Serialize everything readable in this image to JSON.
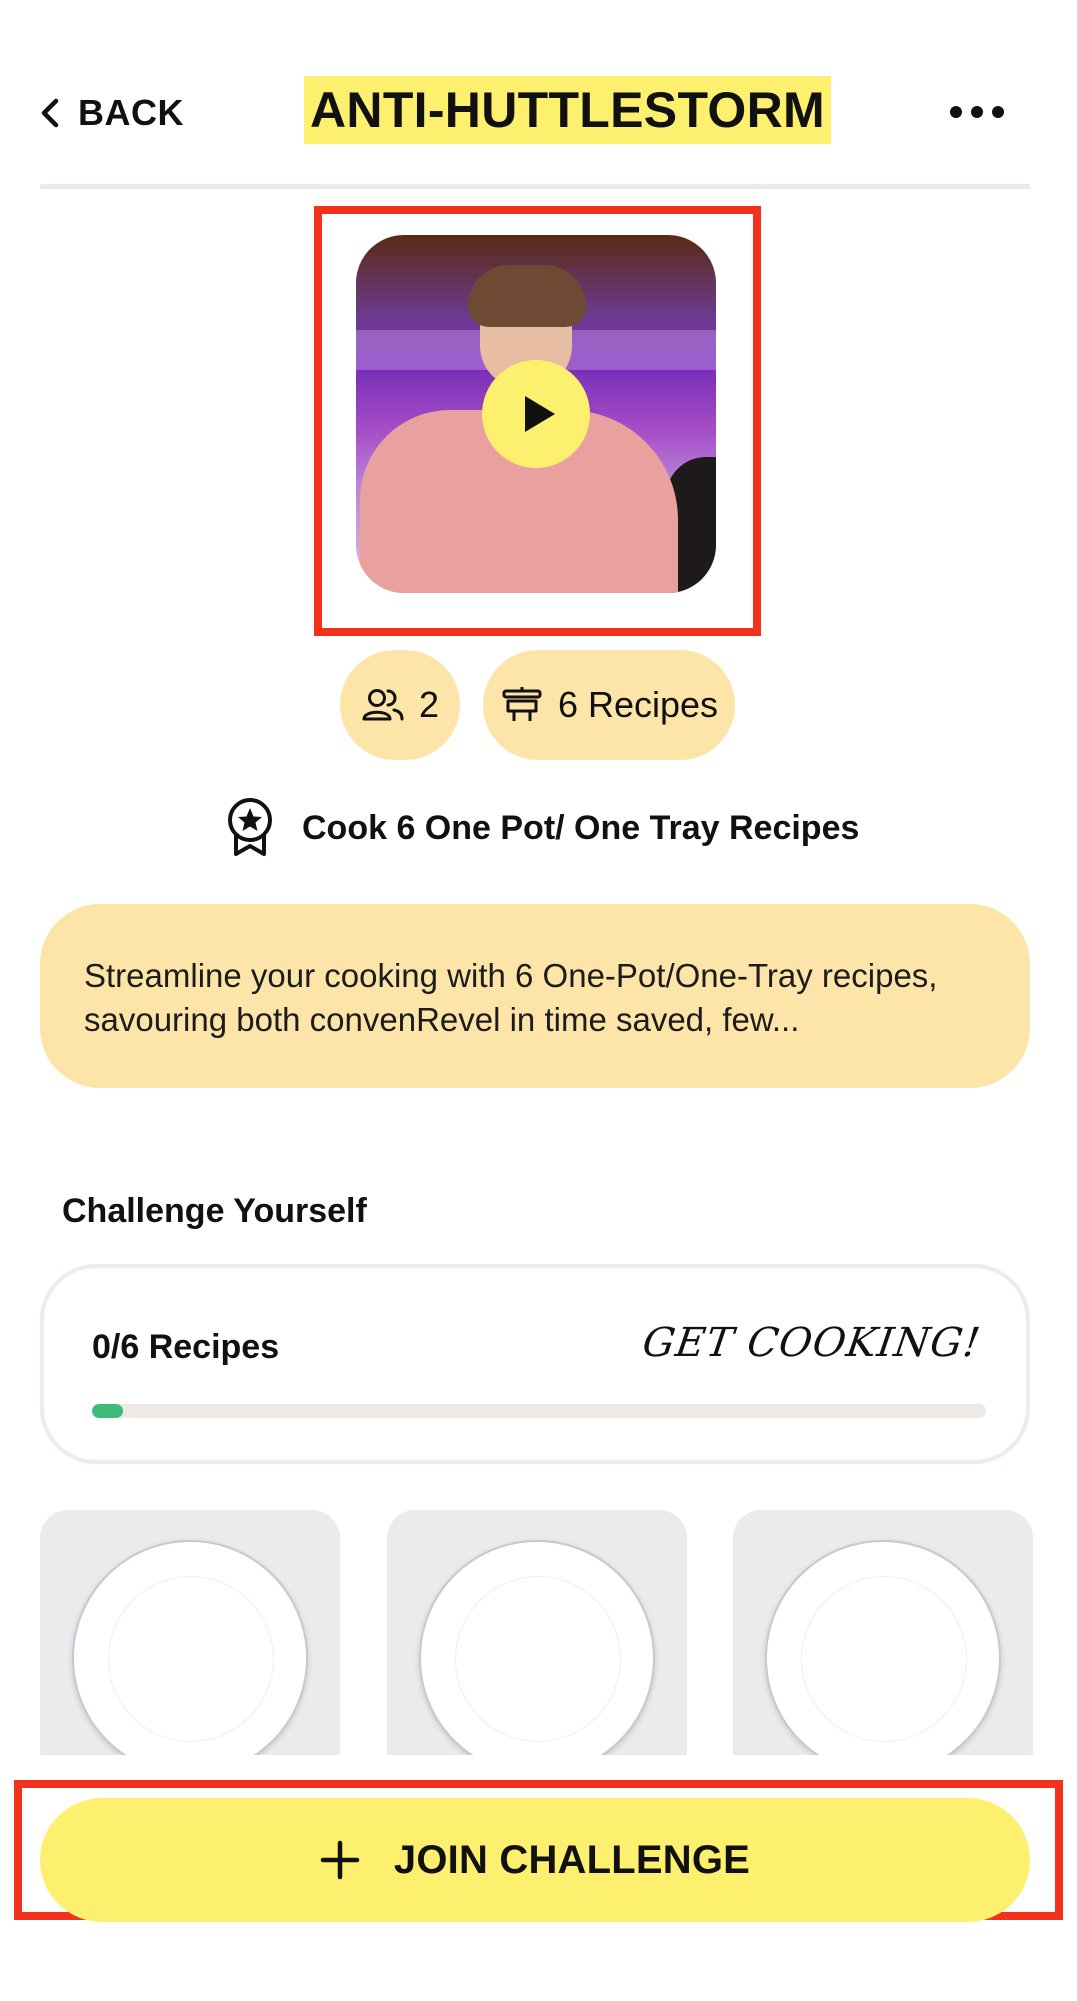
{
  "header": {
    "back_label": "BACK",
    "title": "ANTI-HUTTLESTORM",
    "title_highlight_color": "#fdf06e"
  },
  "video": {
    "play_icon": "play-icon"
  },
  "stats": {
    "members": "2",
    "recipes": "6 Recipes"
  },
  "goal": {
    "icon": "award-badge-icon",
    "text": "Cook 6 One Pot/ One Tray Recipes"
  },
  "description": "Streamline your cooking with 6 One-Pot/One-Tray recipes, savouring both convenRevel in time saved, few...",
  "challenge": {
    "section_title": "Challenge Yourself",
    "progress_label": "0/6 Recipes",
    "tagline": "GET COOKING!",
    "progress_fraction": 0.035,
    "progress_color": "#3dbb7a"
  },
  "plates": [
    "empty-plate",
    "empty-plate",
    "empty-plate"
  ],
  "join_button": {
    "label": "JOIN CHALLENGE",
    "color": "#fdf06e"
  },
  "accent_colors": {
    "pill_background": "#fde4a8",
    "highlight_frame": "#f3311c"
  }
}
